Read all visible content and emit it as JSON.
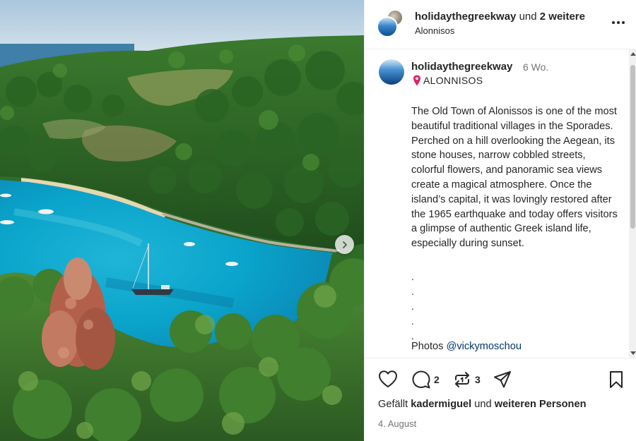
{
  "header": {
    "username": "holidaythegreekway",
    "collab_connector": "und",
    "collab_count": "2 weitere",
    "location": "Alonnisos"
  },
  "caption": {
    "username": "holidaythegreekway",
    "time": "6 Wo.",
    "location": "ALONNISOS",
    "text": "The Old Town of Alonissos is one of the most beautiful traditional villages in the Sporades. Perched on a hill overlooking the Aegean, its stone houses, narrow cobbled streets, colorful flowers, and panoramic sea views create a magical atmosphere. Once the island’s capital, it was lovingly restored after the 1965 earthquake and today offers visitors a glimpse of authentic Greek island life, especially during sunset.",
    "dots": [
      ".",
      ".",
      ".",
      ".",
      "."
    ],
    "photos_label": "Photos",
    "photos_mention": "@vickymoschou"
  },
  "actions": {
    "comment_count": "2",
    "repost_count": "3",
    "likes_prefix": "Gefällt",
    "likes_user": "kadermiguel",
    "likes_middle": "und",
    "likes_others": "weiteren Personen",
    "date": "4. August"
  },
  "icons": {
    "like": "heart-icon",
    "comment": "comment-icon",
    "repost": "repost-icon",
    "share": "send-icon",
    "save": "bookmark-icon",
    "more": "more-icon",
    "next": "chevron-right-icon",
    "pin": "location-pin-icon"
  },
  "colors": {
    "text": "#262626",
    "secondary": "#737373",
    "link": "#00376b",
    "pin": "#e0245e"
  }
}
